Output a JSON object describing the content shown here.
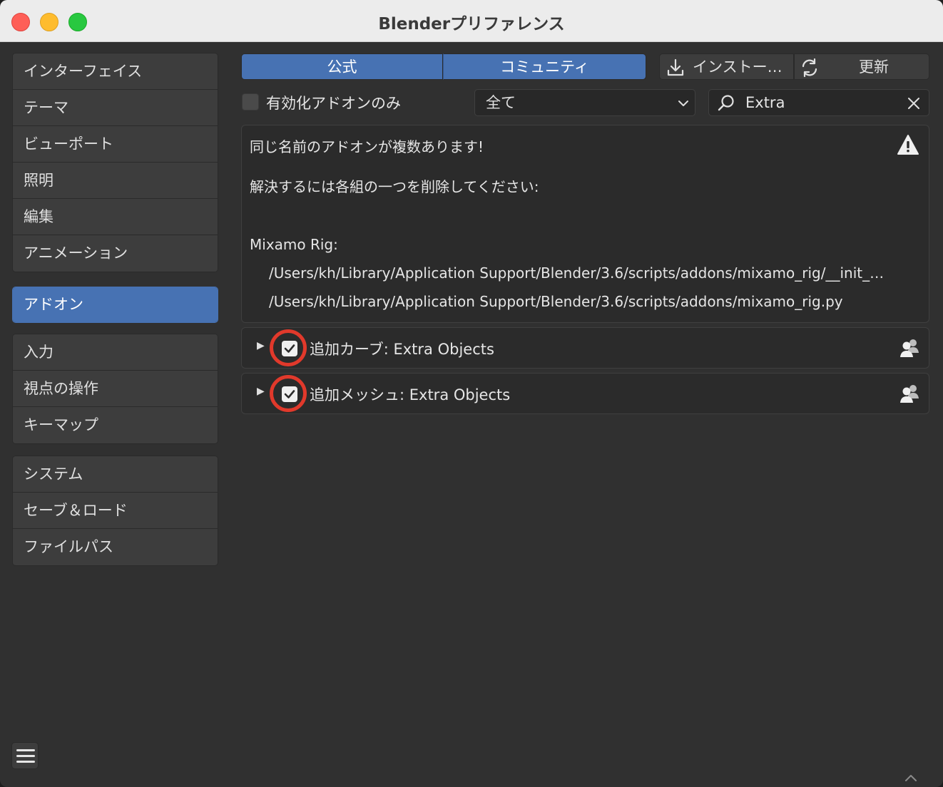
{
  "window": {
    "title": "Blenderプリファレンス"
  },
  "sidebar": {
    "group1": [
      "インターフェイス",
      "テーマ",
      "ビューポート",
      "照明",
      "編集",
      "アニメーション"
    ],
    "group2": [
      "アドオン"
    ],
    "group3": [
      "入力",
      "視点の操作",
      "キーマップ"
    ],
    "group4": [
      "システム",
      "セーブ＆ロード",
      "ファイルパス"
    ],
    "active": "アドオン"
  },
  "tabs": {
    "official": "公式",
    "community": "コミュニティ"
  },
  "toolbar": {
    "install_label": "インストー…",
    "refresh_label": "更新"
  },
  "filters": {
    "enabled_only_label": "有効化アドオンのみ",
    "enabled_only_checked": false,
    "category_value": "全て",
    "search_value": "Extra"
  },
  "warning": {
    "line1": "同じ名前のアドオンが複数あります!",
    "line2": "解決するには各組の一つを削除してください:",
    "addon_name": "Mixamo Rig:",
    "path1": "/Users/kh/Library/Application Support/Blender/3.6/scripts/addons/mixamo_rig/__init_…",
    "path2": "/Users/kh/Library/Application Support/Blender/3.6/scripts/addons/mixamo_rig.py"
  },
  "addons": [
    {
      "label": "追加カーブ: Extra Objects",
      "enabled": true
    },
    {
      "label": "追加メッシュ: Extra Objects",
      "enabled": true
    }
  ],
  "colors": {
    "accent": "#4772b3",
    "highlight_ring": "#e1392b",
    "panel": "#2b2b2b",
    "window_bg": "#303030"
  }
}
